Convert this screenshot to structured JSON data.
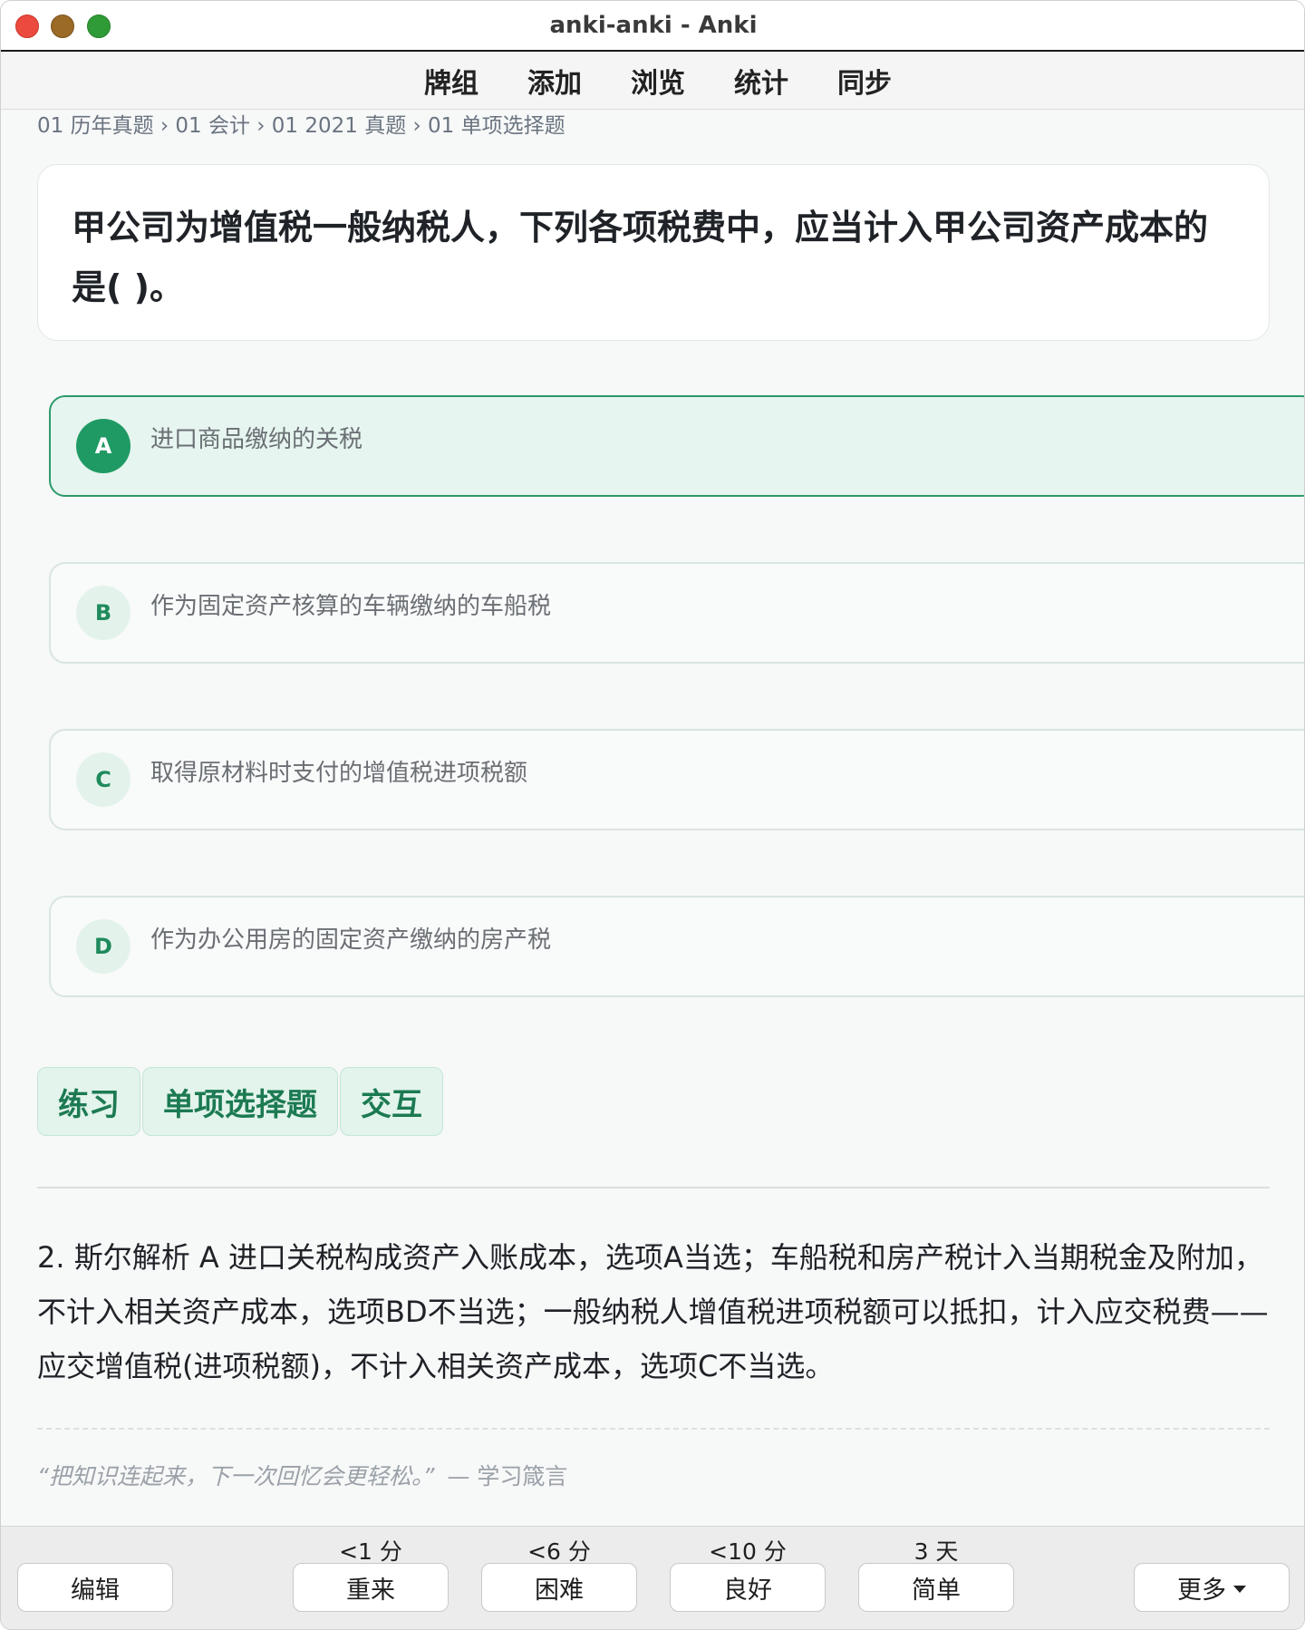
{
  "window": {
    "title": "anki-anki - Anki"
  },
  "menu": {
    "items": [
      "牌组",
      "添加",
      "浏览",
      "统计",
      "同步"
    ]
  },
  "breadcrumb": "01 历年真题 › 01 会计 › 01 2021 真题 › 01 单项选择题",
  "question": "甲公司为增值税一般纳税人，下列各项税费中，应当计入甲公司资产成本的是( )。",
  "options": [
    {
      "letter": "A",
      "text": "进口商品缴纳的关税",
      "selected": true
    },
    {
      "letter": "B",
      "text": "作为固定资产核算的车辆缴纳的车船税",
      "selected": false
    },
    {
      "letter": "C",
      "text": "取得原材料时支付的增值税进项税额",
      "selected": false
    },
    {
      "letter": "D",
      "text": "作为办公用房的固定资产缴纳的房产税",
      "selected": false
    }
  ],
  "tags": [
    "练习",
    "单项选择题",
    "交互"
  ],
  "explanation": "2. 斯尔解析 A 进口关税构成资产入账成本，选项A当选；车船税和房产税计入当期税金及附加，不计入相关资产成本，选项BD不当选；一般纳税人增值税进项税额可以抵扣，计入应交税费——应交增值税(进项税额)，不计入相关资产成本，选项C不当选。",
  "quote": {
    "text": "“把知识连起来，下一次回忆会更轻松。”",
    "source": "— 学习箴言"
  },
  "bottom": {
    "edit_label": "编辑",
    "more_label": "更多",
    "answers": [
      {
        "interval": "<1 分",
        "label": "重来"
      },
      {
        "interval": "<6 分",
        "label": "困难"
      },
      {
        "interval": "<10 分",
        "label": "良好"
      },
      {
        "interval": "3 天",
        "label": "简单"
      }
    ]
  },
  "colors": {
    "accent": "#1f9a64",
    "selected_bg": "#e6f5ef",
    "tag_bg": "#e2f4ec"
  }
}
